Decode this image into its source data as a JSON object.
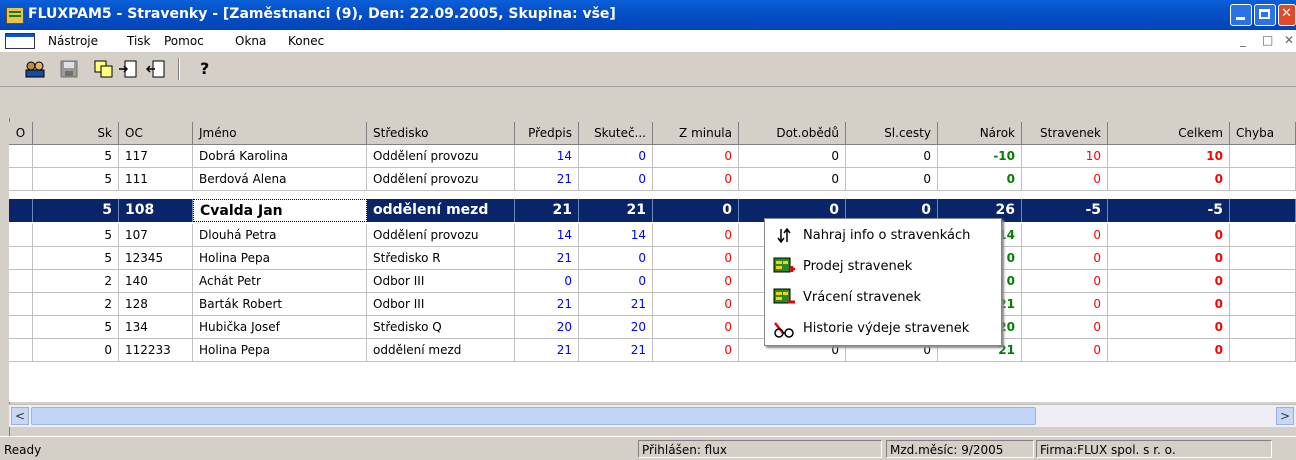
{
  "window": {
    "title": "FLUXPAM5 - Stravenky - [Zaměstnanci (9), Den: 22.09.2005, Skupina: vše]"
  },
  "menu": {
    "items": [
      "Nástroje",
      "Tisk",
      "Pomoc",
      "Okna",
      "Konec"
    ],
    "mdi_controls": [
      "_",
      "□",
      "✕"
    ]
  },
  "toolbar": {
    "icons": [
      "users-icon",
      "save-icon",
      "copy-icon",
      "document-in-icon",
      "document-out-icon",
      "help-icon"
    ],
    "help_glyph": "?"
  },
  "table": {
    "indicator_header": "O",
    "columns": [
      "Sk",
      "OC",
      "Jméno",
      "Středisko",
      "Předpis",
      "Skuteč...",
      "Z minula",
      "Dot.obědů",
      "Sl.cesty",
      "Nárok",
      "Stravenek",
      "Celkem",
      "Chyba"
    ],
    "rows": [
      {
        "sk": "5",
        "oc": "117",
        "jmeno": "Dobrá Karolina",
        "stredisko": "Oddělení provozu",
        "predpis": "14",
        "skutec": "0",
        "zminula": "0",
        "dot": "0",
        "slcesty": "0",
        "narok": "-10",
        "stravenek": "10",
        "celkem": "10",
        "chyba": ""
      },
      {
        "sk": "5",
        "oc": "111",
        "jmeno": "Berdová Alena",
        "stredisko": "Oddělení provozu",
        "predpis": "21",
        "skutec": "0",
        "zminula": "0",
        "dot": "0",
        "slcesty": "0",
        "narok": "0",
        "stravenek": "0",
        "celkem": "0",
        "chyba": ""
      },
      {
        "sk": "5",
        "oc": "108",
        "jmeno": "Cvalda Jan",
        "stredisko": "oddělení mezd",
        "predpis": "21",
        "skutec": "21",
        "zminula": "0",
        "dot": "0",
        "slcesty": "0",
        "narok": "26",
        "stravenek": "-5",
        "celkem": "-5",
        "chyba": "",
        "selected": true
      },
      {
        "sk": "5",
        "oc": "107",
        "jmeno": "Dlouhá Petra",
        "stredisko": "Oddělení provozu",
        "predpis": "14",
        "skutec": "14",
        "zminula": "0",
        "dot": "",
        "slcesty": "",
        "narok": "14",
        "stravenek": "0",
        "celkem": "0",
        "chyba": ""
      },
      {
        "sk": "5",
        "oc": "12345",
        "jmeno": "Holina Pepa",
        "stredisko": "Středisko R",
        "predpis": "21",
        "skutec": "0",
        "zminula": "0",
        "dot": "",
        "slcesty": "",
        "narok": "0",
        "stravenek": "0",
        "celkem": "0",
        "chyba": ""
      },
      {
        "sk": "2",
        "oc": "140",
        "jmeno": "Achát Petr",
        "stredisko": "Odbor III",
        "predpis": "0",
        "skutec": "0",
        "zminula": "0",
        "dot": "",
        "slcesty": "",
        "narok": "0",
        "stravenek": "0",
        "celkem": "0",
        "chyba": ""
      },
      {
        "sk": "2",
        "oc": "128",
        "jmeno": "Barták Robert",
        "stredisko": "Odbor III",
        "predpis": "21",
        "skutec": "21",
        "zminula": "0",
        "dot": "",
        "slcesty": "",
        "narok": "21",
        "stravenek": "0",
        "celkem": "0",
        "chyba": ""
      },
      {
        "sk": "5",
        "oc": "134",
        "jmeno": "Hubička Josef",
        "stredisko": "Středisko Q",
        "predpis": "20",
        "skutec": "20",
        "zminula": "0",
        "dot": "",
        "slcesty": "",
        "narok": "20",
        "stravenek": "0",
        "celkem": "0",
        "chyba": ""
      },
      {
        "sk": "0",
        "oc": "112233",
        "jmeno": "Holina Pepa",
        "stredisko": "oddělení mezd",
        "predpis": "21",
        "skutec": "21",
        "zminula": "0",
        "dot": "0",
        "slcesty": "0",
        "narok": "21",
        "stravenek": "0",
        "celkem": "0",
        "chyba": ""
      }
    ]
  },
  "context_menu": {
    "items": [
      {
        "label": "Nahraj info o stravenkách",
        "icon": "transfer-icon"
      },
      {
        "label": "Prodej stravenek",
        "icon": "sell-vouchers-icon"
      },
      {
        "label": "Vrácení stravenek",
        "icon": "return-vouchers-icon"
      },
      {
        "label": "Historie výdeje stravenek",
        "icon": "history-glasses-icon"
      }
    ]
  },
  "statusbar": {
    "ready": "Ready",
    "logged_in": "Přihlášen: flux",
    "month": "Mzd.měsíc: 9/2005",
    "company": "Firma:FLUX spol. s r. o."
  },
  "colors": {
    "selection": "#0a246a",
    "title_bar": "#0550c7",
    "blue_value": "#0000ff",
    "red_value": "#ff0000",
    "green_value": "#008000"
  }
}
